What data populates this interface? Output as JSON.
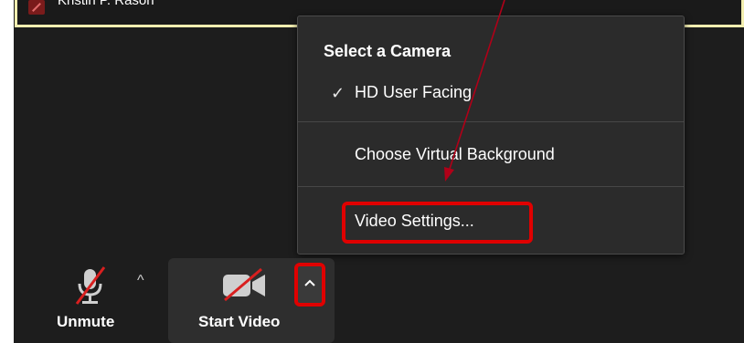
{
  "video_tile": {
    "participant_name": "Kristin P. Rason"
  },
  "camera_menu": {
    "heading": "Select a Camera",
    "selected_camera_label": "HD User Facing",
    "virtual_background_label": "Choose Virtual Background",
    "video_settings_label": "Video Settings..."
  },
  "toolbar": {
    "unmute_label": "Unmute",
    "start_video_label": "Start Video"
  },
  "icons": {
    "mic": "mic-muted-icon",
    "camera": "camera-off-icon",
    "check": "checkmark-icon",
    "caret": "chevron-up-icon"
  },
  "colors": {
    "annotation_red": "#e00000",
    "tile_border": "#f2eeb0",
    "menu_bg": "#2b2b2b",
    "app_bg": "#1d1d1d"
  }
}
